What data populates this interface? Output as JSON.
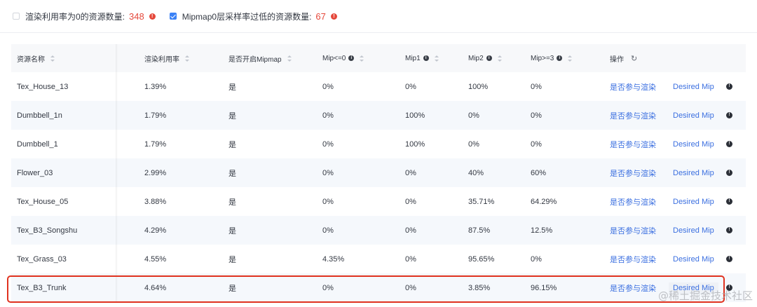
{
  "filters": [
    {
      "label": "渲染利用率为0的资源数量:",
      "count": "348",
      "checked": false
    },
    {
      "label": "Mipmap0层采样率过低的资源数量:",
      "count": "67",
      "checked": true
    }
  ],
  "table": {
    "columns": {
      "name": "资源名称",
      "rate": "渲染利用率",
      "mipmap": "是否开启Mipmap",
      "mip0": "Mip<=0",
      "mip1": "Mip1",
      "mip2": "Mip2",
      "mip3": "Mip>=3",
      "action": "操作"
    },
    "action_labels": {
      "render": "是否参与渲染",
      "desired": "Desired Mip"
    },
    "rows": [
      {
        "name": "Tex_House_13",
        "rate": "1.39%",
        "mipmap": "是",
        "mip0": "0%",
        "mip1": "0%",
        "mip2": "100%",
        "mip3": "0%"
      },
      {
        "name": "Dumbbell_1n",
        "rate": "1.79%",
        "mipmap": "是",
        "mip0": "0%",
        "mip1": "100%",
        "mip2": "0%",
        "mip3": "0%"
      },
      {
        "name": "Dumbbell_1",
        "rate": "1.79%",
        "mipmap": "是",
        "mip0": "0%",
        "mip1": "100%",
        "mip2": "0%",
        "mip3": "0%"
      },
      {
        "name": "Flower_03",
        "rate": "2.99%",
        "mipmap": "是",
        "mip0": "0%",
        "mip1": "0%",
        "mip2": "40%",
        "mip3": "60%"
      },
      {
        "name": "Tex_House_05",
        "rate": "3.88%",
        "mipmap": "是",
        "mip0": "0%",
        "mip1": "0%",
        "mip2": "35.71%",
        "mip3": "64.29%"
      },
      {
        "name": "Tex_B3_Songshu",
        "rate": "4.29%",
        "mipmap": "是",
        "mip0": "0%",
        "mip1": "0%",
        "mip2": "87.5%",
        "mip3": "12.5%"
      },
      {
        "name": "Tex_Grass_03",
        "rate": "4.55%",
        "mipmap": "是",
        "mip0": "4.35%",
        "mip1": "0%",
        "mip2": "95.65%",
        "mip3": "0%"
      },
      {
        "name": "Tex_B3_Trunk",
        "rate": "4.64%",
        "mipmap": "是",
        "mip0": "0%",
        "mip1": "0%",
        "mip2": "3.85%",
        "mip3": "96.15%"
      }
    ]
  },
  "watermark": "@稀土掘金技术社区",
  "colors": {
    "accent": "#3b6fe0",
    "warning": "#e5483b",
    "highlight_border": "#e0321f"
  }
}
